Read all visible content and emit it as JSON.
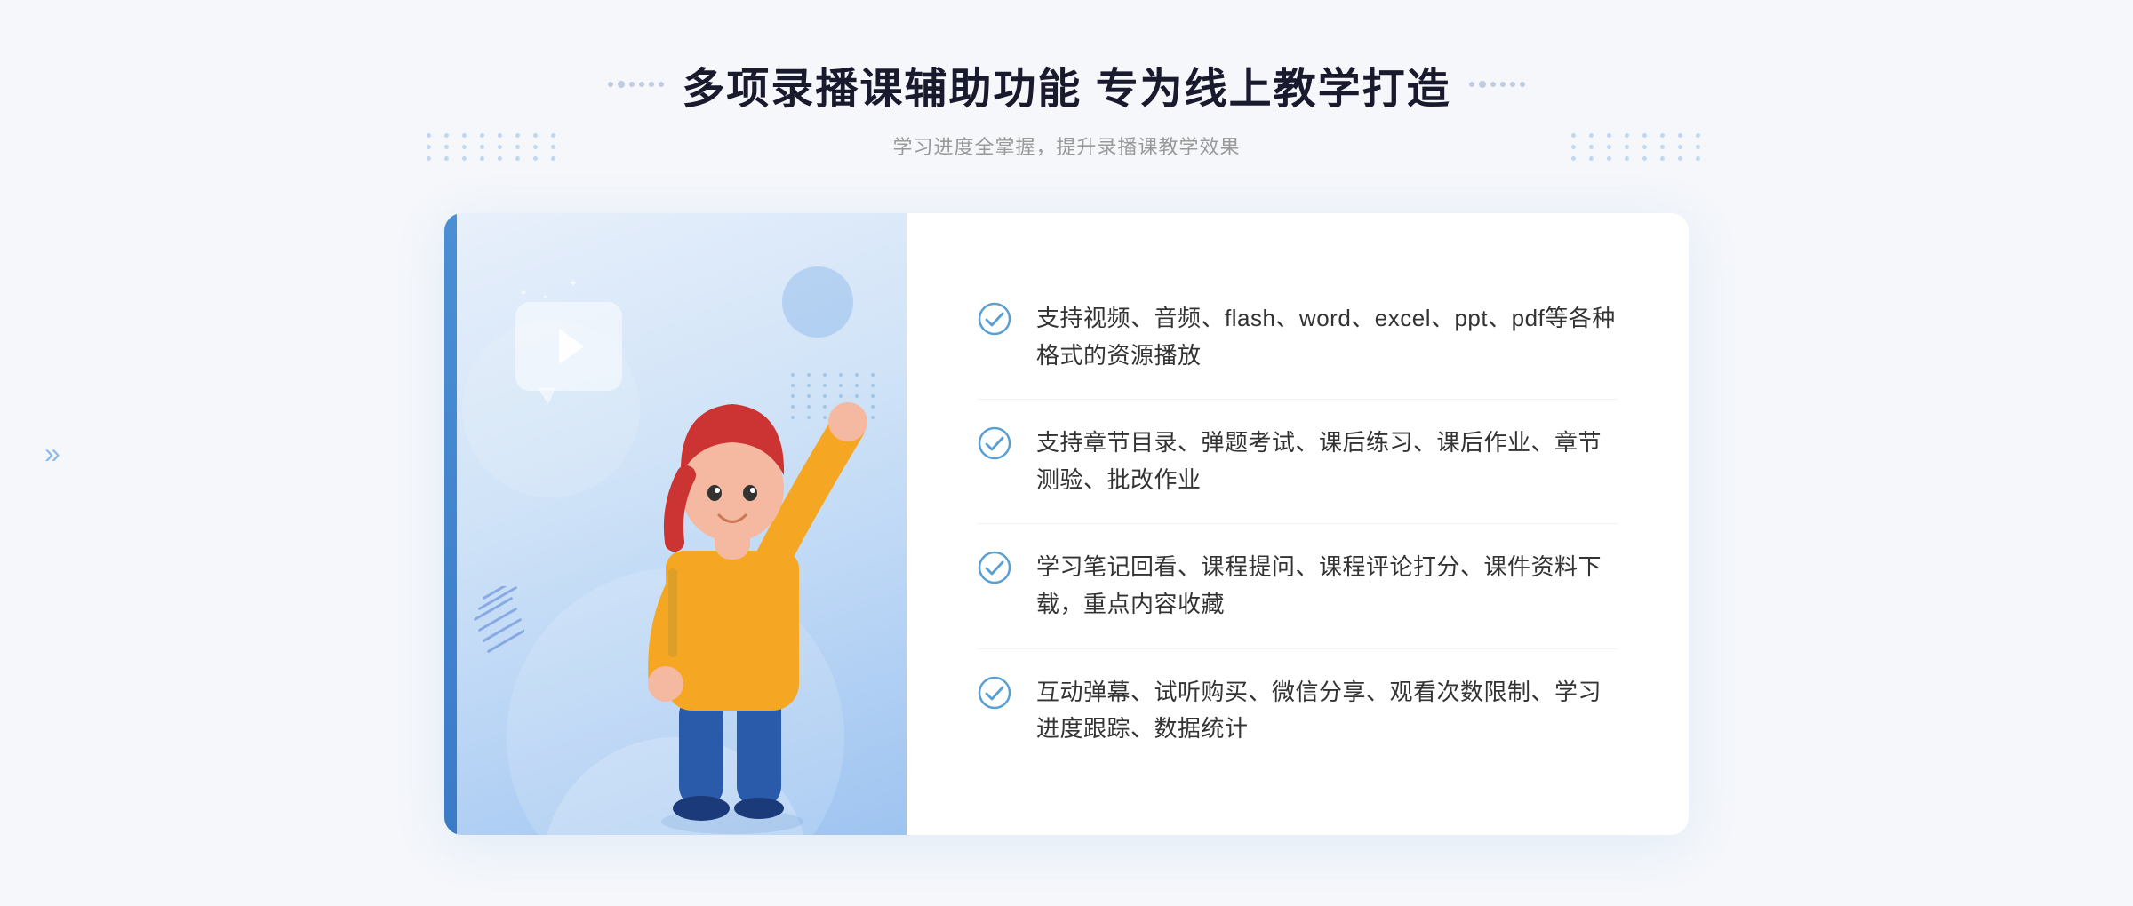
{
  "header": {
    "title": "多项录播课辅助功能 专为线上教学打造",
    "subtitle": "学习进度全掌握，提升录播课教学效果",
    "title_decoration_left": "decoration",
    "title_decoration_right": "decoration"
  },
  "features": [
    {
      "id": 1,
      "text": "支持视频、音频、flash、word、excel、ppt、pdf等各种格式的资源播放"
    },
    {
      "id": 2,
      "text": "支持章节目录、弹题考试、课后练习、课后作业、章节测验、批改作业"
    },
    {
      "id": 3,
      "text": "学习笔记回看、课程提问、课程评论打分、课件资料下载，重点内容收藏"
    },
    {
      "id": 4,
      "text": "互动弹幕、试听购买、微信分享、观看次数限制、学习进度跟踪、数据统计"
    }
  ],
  "colors": {
    "primary": "#4a8fd4",
    "primary_light": "#7bb3e8",
    "text_dark": "#1a1a2e",
    "text_medium": "#333333",
    "text_light": "#999999",
    "accent": "#3a7bc8",
    "check_color": "#5a9fd4"
  },
  "decoration": {
    "chevron_symbol": "»",
    "star_symbol": "✦",
    "dots_count": 48
  }
}
